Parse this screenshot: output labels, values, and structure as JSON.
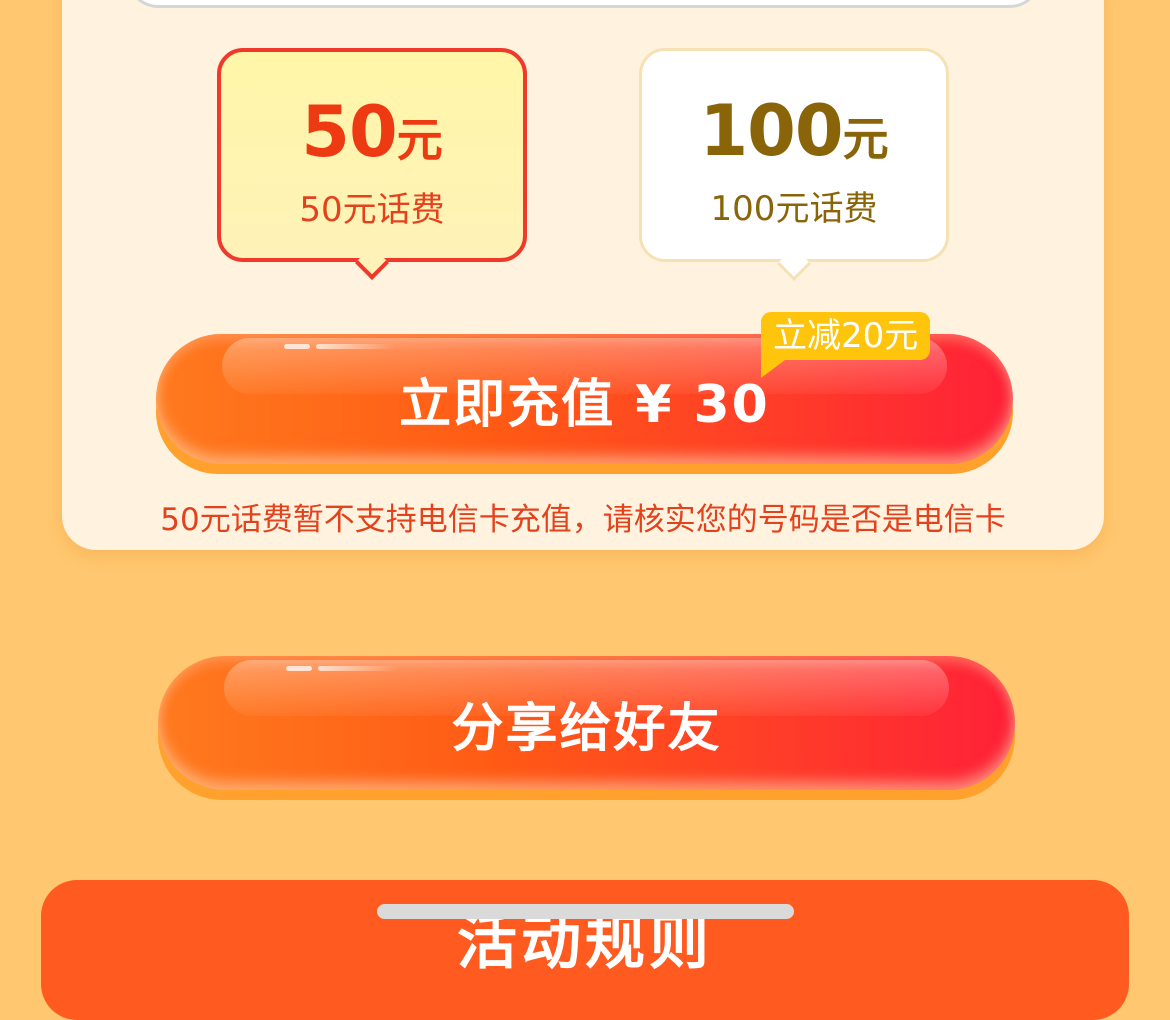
{
  "options": [
    {
      "amount": "50",
      "unit": "元",
      "desc": "50元话费",
      "selected": true
    },
    {
      "amount": "100",
      "unit": "元",
      "desc": "100元话费",
      "selected": false
    }
  ],
  "recharge_button": {
    "label": "立即充值 ¥ 30"
  },
  "discount_badge": {
    "text": "立减20元"
  },
  "notice": "50元话费暂不支持电信卡充值，请核实您的号码是否是电信卡",
  "share_button": {
    "label": "分享给好友"
  },
  "rules": {
    "title": "活动规则"
  },
  "colors": {
    "page_background": "#FFC76F",
    "card_background": "#FFF3E0",
    "accent_red": "#EE3A12",
    "gold_text": "#8A6409",
    "badge_yellow": "#FFC40C",
    "rules_orange": "#FF5A1F"
  }
}
